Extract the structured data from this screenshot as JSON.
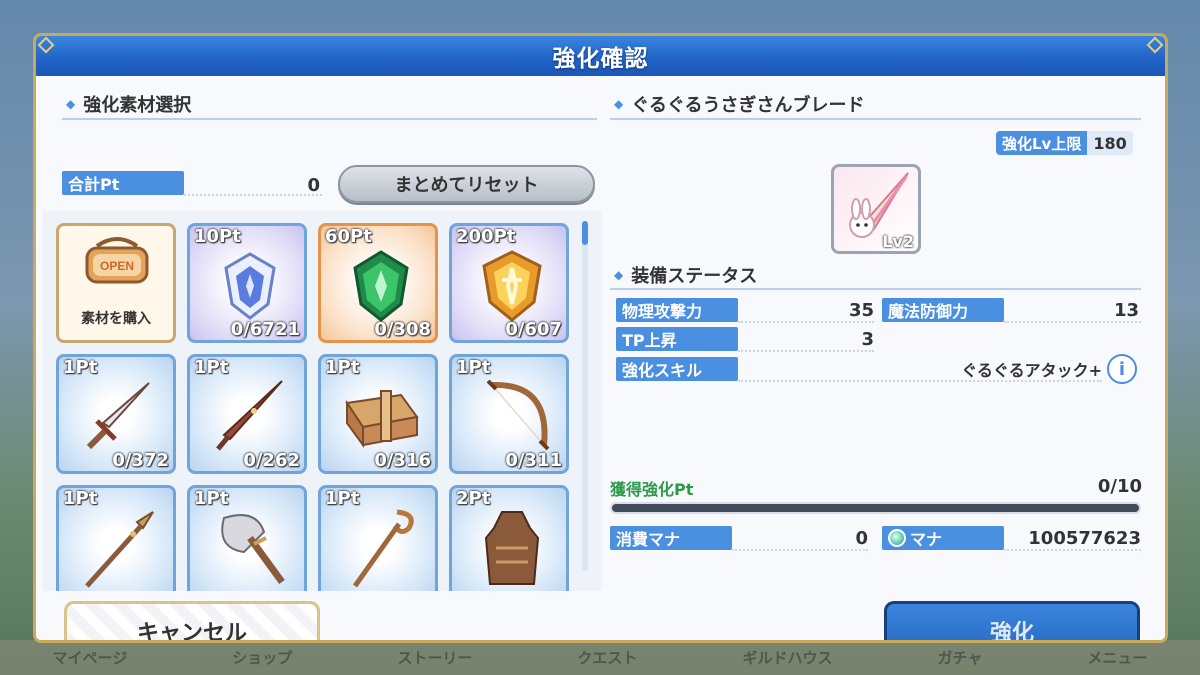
{
  "background": {
    "nav": [
      "マイページ",
      "ショップ",
      "ストーリー",
      "クエスト",
      "ギルドハウス",
      "ガチャ",
      "メニュー"
    ]
  },
  "dialog": {
    "title": "強化確認",
    "left": {
      "section_title": "強化素材選択",
      "total_pt_label": "合計Pt",
      "total_pt_value": "0",
      "reset_button": "まとめてリセット",
      "materials": [
        {
          "type": "shop",
          "sign": "OPEN",
          "label": "素材を購入",
          "icon": "shop-sign-icon"
        },
        {
          "pt": "10Pt",
          "count": "0/6721",
          "icon": "blue-crystal-icon",
          "color": "purple"
        },
        {
          "pt": "60Pt",
          "count": "0/308",
          "icon": "green-crystal-icon",
          "color": "orange"
        },
        {
          "pt": "200Pt",
          "count": "0/607",
          "icon": "gold-crystal-icon",
          "color": "purple"
        },
        {
          "pt": "1Pt",
          "count": "0/372",
          "icon": "sword-icon",
          "color": "blue"
        },
        {
          "pt": "1Pt",
          "count": "0/262",
          "icon": "dagger-icon",
          "color": "blue"
        },
        {
          "pt": "1Pt",
          "count": "0/316",
          "icon": "shield-box-icon",
          "color": "blue"
        },
        {
          "pt": "1Pt",
          "count": "0/311",
          "icon": "bow-icon",
          "color": "blue"
        },
        {
          "pt": "1Pt",
          "count": "",
          "icon": "spear-icon",
          "color": "blue"
        },
        {
          "pt": "1Pt",
          "count": "",
          "icon": "axe-icon",
          "color": "blue"
        },
        {
          "pt": "1Pt",
          "count": "",
          "icon": "staff-icon",
          "color": "blue"
        },
        {
          "pt": "2Pt",
          "count": "",
          "icon": "armor-icon",
          "color": "blue"
        }
      ]
    },
    "right": {
      "item_name": "ぐるぐるうさぎさんブレード",
      "limit_label": "強化Lv上限",
      "limit_value": "180",
      "item_level": "Lv2",
      "status_title": "装備ステータス",
      "stats": [
        {
          "label": "物理攻撃力",
          "value": "35"
        },
        {
          "label": "魔法防御力",
          "value": "13"
        },
        {
          "label": "TP上昇",
          "value": "3"
        }
      ],
      "skill_label": "強化スキル",
      "skill_value": "ぐるぐるアタック+",
      "info_icon": "i",
      "gain_label": "獲得強化Pt",
      "gain_value": "0/10",
      "gain_progress": 0,
      "mana_cost_label": "消費マナ",
      "mana_cost_value": "0",
      "mana_label": "マナ",
      "mana_value": "100577623"
    },
    "cancel_button": "キャンセル",
    "enhance_button": "強化"
  },
  "colors": {
    "accent": "#4a8fe0",
    "title_bar": "#2264c8",
    "progress_fill": "#4fc06a",
    "gain_label": "#2c9a4a"
  }
}
